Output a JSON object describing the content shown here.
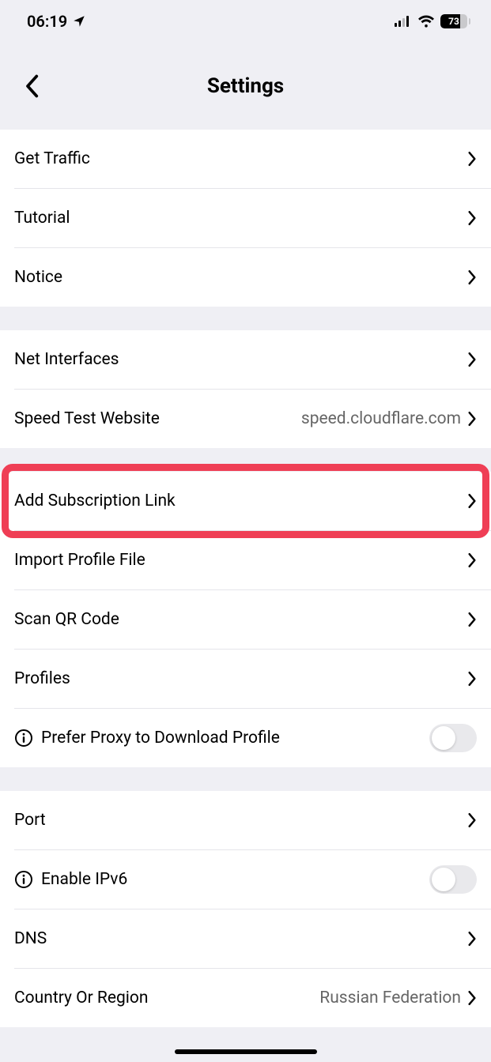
{
  "status": {
    "time": "06:19",
    "battery_pct": "73"
  },
  "nav": {
    "title": "Settings"
  },
  "section1": {
    "get_traffic": "Get Traffic",
    "tutorial": "Tutorial",
    "notice": "Notice"
  },
  "section2": {
    "net_interfaces": "Net Interfaces",
    "speed_test_label": "Speed Test Website",
    "speed_test_value": "speed.cloudflare.com"
  },
  "section3": {
    "add_subscription": "Add Subscription Link",
    "import_profile": "Import Profile File",
    "scan_qr": "Scan QR Code",
    "profiles": "Profiles",
    "prefer_proxy": "Prefer Proxy to Download Profile"
  },
  "section4": {
    "port": "Port",
    "enable_ipv6": "Enable IPv6",
    "dns": "DNS",
    "country_label": "Country Or Region",
    "country_value": "Russian Federation"
  }
}
